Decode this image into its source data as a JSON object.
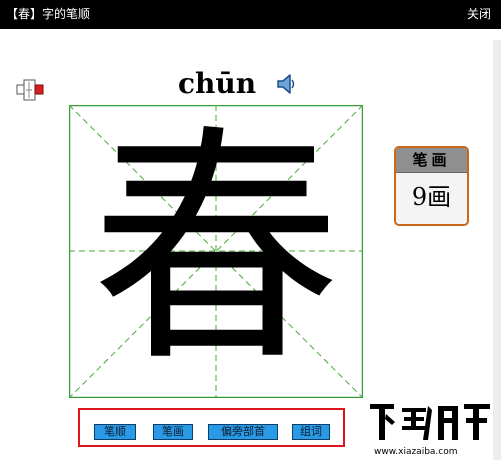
{
  "window": {
    "title": "【春】字的笔顺",
    "close_label": "关闭"
  },
  "character": {
    "pinyin": "chūn",
    "glyph": "春"
  },
  "strokes": {
    "header": "笔画",
    "count": "9画"
  },
  "buttons": {
    "stroke_order": "笔顺",
    "strokes": "笔画",
    "radical": "偏旁部首",
    "words": "组词"
  },
  "watermark": {
    "url": "www.xiazaiba.com"
  },
  "icons": {
    "cursor": "cursor-pointer-icon",
    "speaker": "speaker-icon"
  },
  "colors": {
    "grid_border": "#3a9b3a",
    "grid_dash": "#4aa83a",
    "button_fill": "#2b9ae6",
    "highlight": "#e0141e",
    "stroke_box_border": "#c9671b"
  }
}
